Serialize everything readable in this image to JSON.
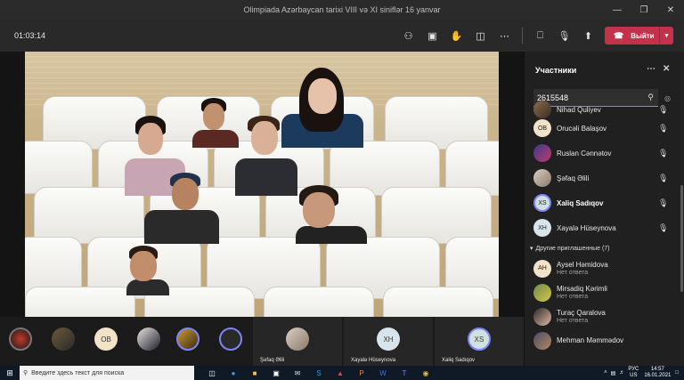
{
  "window": {
    "title": "Olimpiada Azərbaycan tarixi VIII və XI siniflər 16 yanvar"
  },
  "toolbar": {
    "timer": "01:03:14",
    "leave_label": "Выйти",
    "icons": [
      "people-icon",
      "chat-icon",
      "raise-hand-icon",
      "share-tray-icon",
      "more-icon",
      "camera-off-icon",
      "mic-icon",
      "share-screen-icon"
    ]
  },
  "participants_panel": {
    "title": "Участники",
    "search_value": "2615548",
    "in_meeting": [
      {
        "name": "Nihad Quliyev",
        "avatar": "photo"
      },
      {
        "name": "Orucəli Balaşov",
        "avatar": "initials",
        "initials": "OB"
      },
      {
        "name": "Ruslan Cənnətov",
        "avatar": "photo"
      },
      {
        "name": "Şəfaq Əlili",
        "avatar": "photo"
      },
      {
        "name": "Xaliq Sadıqov",
        "avatar": "initials",
        "initials": "XS",
        "active": true
      },
      {
        "name": "Xayalə Hüseynova",
        "avatar": "initials",
        "initials": "XH"
      }
    ],
    "others_section": "Другие приглашенные (7)",
    "invited": [
      {
        "name": "Aysel Həmidova",
        "status": "Нет ответа",
        "avatar": "initials",
        "initials": "AH"
      },
      {
        "name": "Mirsadiq Kərimli",
        "status": "Нет ответа",
        "avatar": "photo"
      },
      {
        "name": "Turaç Qaralova",
        "status": "Нет ответа",
        "avatar": "photo"
      },
      {
        "name": "Mehman Məmmədov",
        "status": "",
        "avatar": "photo"
      }
    ]
  },
  "strip": {
    "small_avatars": [
      {
        "initials": "",
        "kind": "photo"
      },
      {
        "initials": "",
        "kind": "photo"
      },
      {
        "initials": "OB",
        "kind": "initials"
      },
      {
        "initials": "",
        "kind": "photo"
      },
      {
        "initials": "",
        "kind": "photo"
      },
      {
        "initials": "",
        "kind": "photo"
      }
    ],
    "tiles": [
      {
        "name": "Şəfaq Əlili",
        "initials": ""
      },
      {
        "name": "Xayalə Hüseynova",
        "initials": "XH"
      },
      {
        "name": "Xaliq Sadıqov",
        "initials": "XS"
      }
    ]
  },
  "taskbar": {
    "search_placeholder": "Введите здесь текст для поиска",
    "lang_top": "РУС",
    "lang_bottom": "US",
    "time": "14:57",
    "date": "16.01.2021"
  }
}
